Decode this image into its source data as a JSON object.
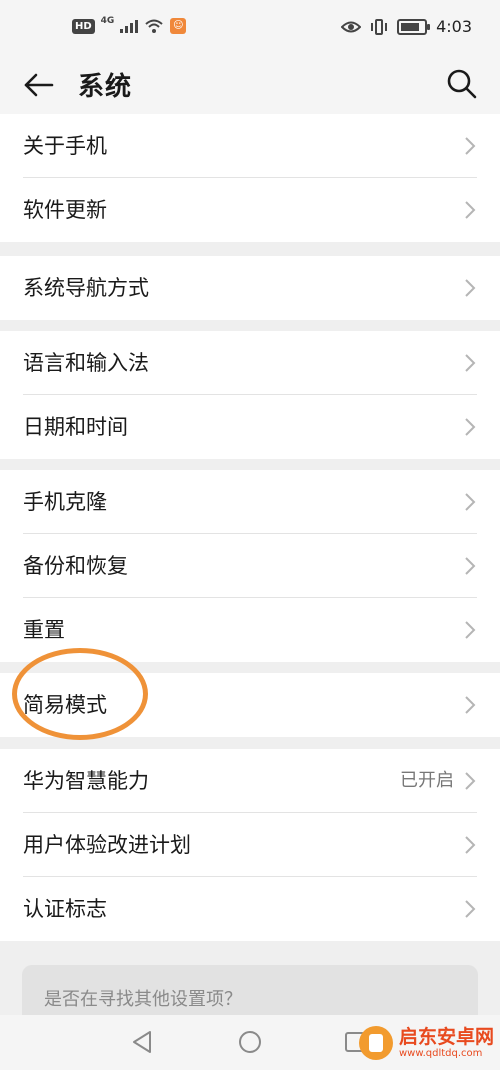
{
  "status_bar": {
    "hd_label": "HD",
    "network_label": "4G",
    "time": "4:03"
  },
  "header": {
    "title": "系统"
  },
  "groups": [
    {
      "items": [
        {
          "label": "关于手机"
        },
        {
          "label": "软件更新"
        }
      ]
    },
    {
      "items": [
        {
          "label": "系统导航方式"
        }
      ]
    },
    {
      "items": [
        {
          "label": "语言和输入法"
        },
        {
          "label": "日期和时间"
        }
      ]
    },
    {
      "items": [
        {
          "label": "手机克隆"
        },
        {
          "label": "备份和恢复"
        },
        {
          "label": "重置"
        }
      ]
    },
    {
      "items": [
        {
          "label": "简易模式",
          "highlighted": true
        }
      ]
    },
    {
      "items": [
        {
          "label": "华为智慧能力",
          "status": "已开启"
        },
        {
          "label": "用户体验改进计划"
        },
        {
          "label": "认证标志"
        }
      ]
    }
  ],
  "suggestion": {
    "text": "是否在寻找其他设置项？"
  },
  "watermark": {
    "brand": "启东安卓网",
    "url": "www.qdltdq.com"
  },
  "colors": {
    "highlight_ring": "#ef9238",
    "background": "#efefef",
    "card": "#ffffff",
    "watermark_text": "#e84a1f"
  }
}
